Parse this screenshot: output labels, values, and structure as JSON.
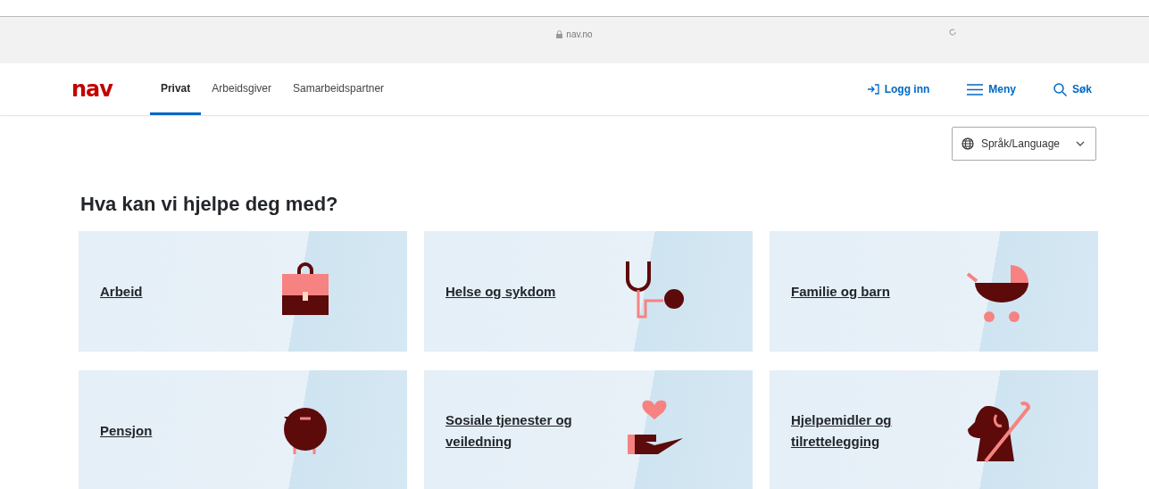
{
  "browser": {
    "address": "nav.no"
  },
  "header": {
    "logo": "nav",
    "tabs": [
      {
        "label": "Privat",
        "selected": true
      },
      {
        "label": "Arbeidsgiver",
        "selected": false
      },
      {
        "label": "Samarbeidspartner",
        "selected": false
      }
    ],
    "actions": [
      {
        "kind": "login",
        "label": "Logg inn"
      },
      {
        "kind": "menu",
        "label": "Meny"
      },
      {
        "kind": "search",
        "label": "Søk"
      }
    ]
  },
  "language": {
    "label": "Språk/Language"
  },
  "heading": "Hva kan vi hjelpe deg med?",
  "cards": [
    {
      "kind": "briefcase",
      "label": "Arbeid"
    },
    {
      "kind": "stethoscope",
      "label": "Helse og sykdom"
    },
    {
      "kind": "stroller",
      "label": "Familie og barn"
    },
    {
      "kind": "piggybank",
      "label": "Pensjon"
    },
    {
      "kind": "hand-heart",
      "label": "Sosiale tjenester og veiledning"
    },
    {
      "kind": "dog",
      "label": "Hjelpemidler og tilrettelegging"
    }
  ]
}
